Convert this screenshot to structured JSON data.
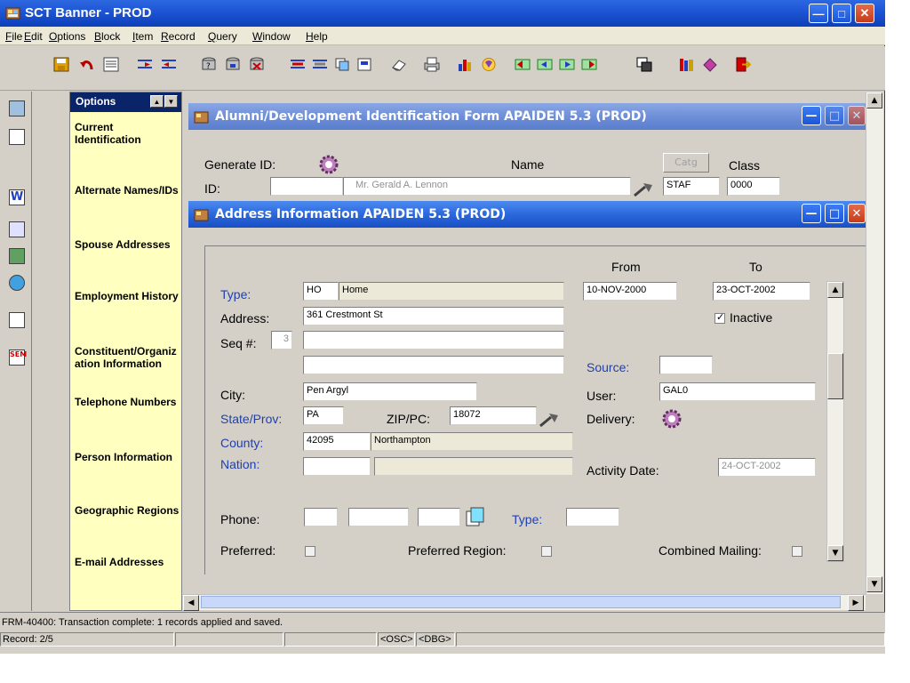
{
  "app": {
    "title": "SCT Banner - PROD"
  },
  "menu": [
    "File",
    "Edit",
    "Options",
    "Block",
    "Item",
    "Record",
    "Query",
    "Window",
    "Help"
  ],
  "options_panel": {
    "header": "Options",
    "items": [
      "Current Identification",
      "Alternate Names/IDs",
      "Spouse Addresses",
      "Employment History",
      "Constituent/Organization Information",
      "Telephone Numbers",
      "Person Information",
      "Geographic Regions",
      "E-mail Addresses"
    ]
  },
  "alumni_form": {
    "title": "Alumni/Development Identification Form  APAIDEN  5.3  (PROD)",
    "generate_id_label": "Generate ID:",
    "name_label": "Name",
    "catg_label": "Catg",
    "class_label": "Class",
    "id_label": "ID:",
    "id_value": "",
    "name_value": "Mr. Gerald A. Lennon",
    "catg_value": "STAF",
    "class_value": "0000"
  },
  "address_form": {
    "title": "Address Information  APAIDEN  5.3  (PROD)",
    "from_label": "From",
    "to_label": "To",
    "type_label": "Type:",
    "type_code": "HO",
    "type_desc": "Home",
    "from_value": "10-NOV-2000",
    "to_value": "23-OCT-2002",
    "address_label": "Address:",
    "address_line1": "361 Crestmont St",
    "address_line2": "",
    "address_line3": "",
    "inactive_label": "Inactive",
    "seq_label": "Seq #:",
    "seq_value": "3",
    "source_label": "Source:",
    "source_value": "",
    "city_label": "City:",
    "city_value": "Pen Argyl",
    "user_label": "User:",
    "user_value": "GAL0",
    "state_label": "State/Prov:",
    "state_value": "PA",
    "zip_label": "ZIP/PC:",
    "zip_value": "18072",
    "delivery_label": "Delivery:",
    "county_label": "County:",
    "county_code": "42095",
    "county_desc": "Northampton",
    "nation_label": "Nation:",
    "nation_value": "",
    "activity_label": "Activity Date:",
    "activity_value": "24-OCT-2002",
    "phone_label": "Phone:",
    "phone_type_label": "Type:",
    "preferred_label": "Preferred:",
    "pref_region_label": "Preferred Region:",
    "combined_label": "Combined Mailing:"
  },
  "status": {
    "message": "FRM-40400: Transaction complete: 1 records applied and saved.",
    "record": "Record: 2/5",
    "osc": "<OSC>",
    "dbg": "<DBG>"
  }
}
